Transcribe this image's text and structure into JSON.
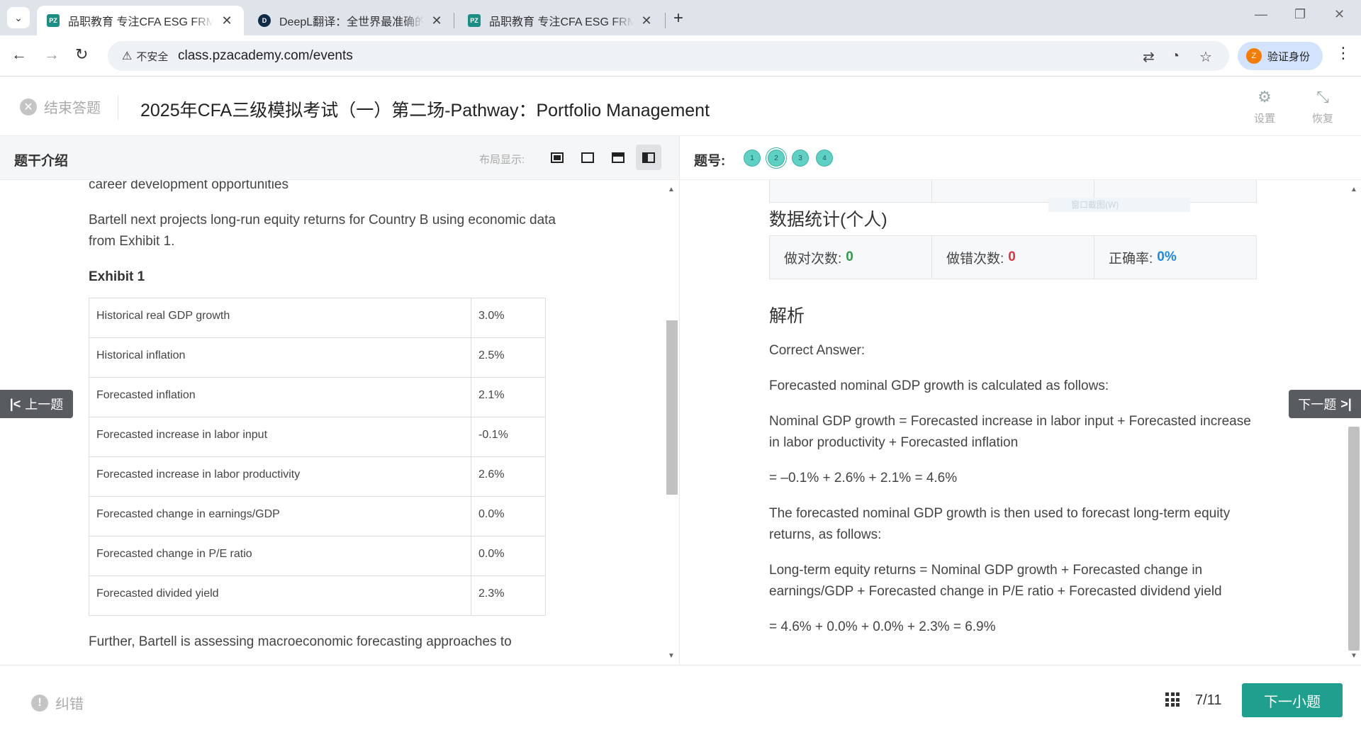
{
  "browser": {
    "tabs": [
      {
        "title": "品职教育 专注CFA ESG FRM CFA",
        "favicon": "PZ"
      },
      {
        "title": "DeepL翻译：全世界最准确的翻译",
        "favicon": "D"
      },
      {
        "title": "品职教育 专注CFA ESG FRM CFA",
        "favicon": "PZ"
      }
    ],
    "insecure_label": "不安全",
    "url": "class.pzacademy.com/events",
    "profile_label": "验证身份",
    "profile_initial": "Z"
  },
  "header": {
    "end_label": "结束答题",
    "title": "2025年CFA三级模拟考试（一）第二场-Pathway：Portfolio Management",
    "settings_label": "设置",
    "restore_label": "恢复"
  },
  "left": {
    "title": "题干介绍",
    "layout_label": "布局显示:",
    "partial_line": "career development opportunities",
    "para1": "Bartell next projects long-run equity returns for Country B using economic data from Exhibit 1.",
    "exhibit_title": "Exhibit 1",
    "table": [
      {
        "label": "Historical real GDP growth",
        "value": "3.0%"
      },
      {
        "label": "Historical inflation",
        "value": "2.5%"
      },
      {
        "label": "Forecasted inflation",
        "value": "2.1%"
      },
      {
        "label": "Forecasted increase in labor input",
        "value": "-0.1%"
      },
      {
        "label": "Forecasted increase in labor productivity",
        "value": "2.6%"
      },
      {
        "label": "Forecasted change in earnings/GDP",
        "value": "0.0%"
      },
      {
        "label": "Forecasted change in P/E ratio",
        "value": "0.0%"
      },
      {
        "label": "Forecasted divided yield",
        "value": "2.3%"
      }
    ],
    "para_tail": "Further, Bartell is assessing macroeconomic forecasting approaches to"
  },
  "right": {
    "qno_label": "题号:",
    "questions": [
      "1",
      "2",
      "3",
      "4"
    ],
    "ghost_tip": "窗口截图(W)",
    "personal_stats_title": "数据统计(个人)",
    "stats": {
      "correct_label": "做对次数:",
      "correct_value": "0",
      "wrong_label": "做错次数:",
      "wrong_value": "0",
      "rate_label": "正确率:",
      "rate_value": "0%"
    },
    "analysis_title": "解析",
    "analysis": [
      "Correct Answer:",
      "Forecasted nominal GDP growth is calculated as follows:",
      "Nominal GDP growth = Forecasted increase in labor input + Forecasted increase in labor productivity + Forecasted inflation",
      "= –0.1% + 2.6% + 2.1% = 4.6%",
      "The forecasted nominal GDP growth is then used to forecast long-term equity returns, as follows:",
      "Long-term equity returns = Nominal GDP growth + Forecasted change in earnings/GDP + Forecasted change in P/E ratio + Forecasted dividend yield",
      "= 4.6% + 0.0% + 0.0% + 2.3% = 6.9%"
    ]
  },
  "nav": {
    "prev_label": "上一题",
    "next_label": "下一题"
  },
  "footer": {
    "report_label": "纠错",
    "progress": "7/11",
    "next_sub_label": "下一小题"
  },
  "colors": {
    "accent": "#1fa08f",
    "correct": "#2e9b4c",
    "wrong": "#d9363e",
    "rate": "#1e88e5",
    "question_dot": "#5fd1c4"
  }
}
